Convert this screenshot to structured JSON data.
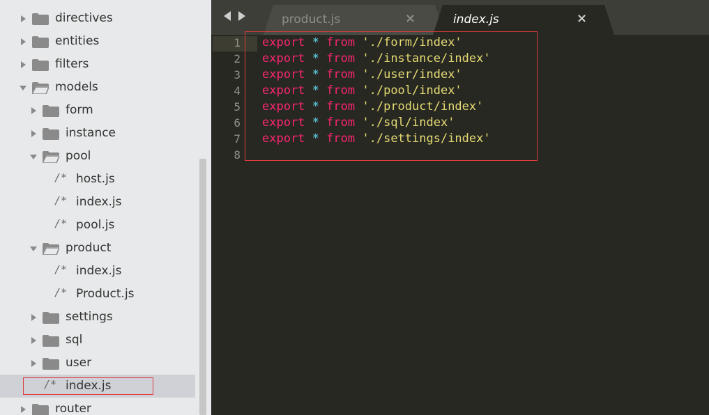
{
  "sidebar": {
    "items": [
      {
        "label": "directives",
        "kind": "folder",
        "state": "collapsed"
      },
      {
        "label": "entities",
        "kind": "folder",
        "state": "collapsed"
      },
      {
        "label": "filters",
        "kind": "folder",
        "state": "collapsed"
      },
      {
        "label": "models",
        "kind": "folder",
        "state": "expanded"
      },
      {
        "label": "form",
        "kind": "folder",
        "state": "collapsed"
      },
      {
        "label": "instance",
        "kind": "folder",
        "state": "collapsed"
      },
      {
        "label": "pool",
        "kind": "folder",
        "state": "expanded"
      },
      {
        "label": "host.js",
        "kind": "file",
        "icon": "/*"
      },
      {
        "label": "index.js",
        "kind": "file",
        "icon": "/*"
      },
      {
        "label": "pool.js",
        "kind": "file",
        "icon": "/*"
      },
      {
        "label": "product",
        "kind": "folder",
        "state": "expanded"
      },
      {
        "label": "index.js",
        "kind": "file",
        "icon": "/*"
      },
      {
        "label": "Product.js",
        "kind": "file",
        "icon": "/*"
      },
      {
        "label": "settings",
        "kind": "folder",
        "state": "collapsed"
      },
      {
        "label": "sql",
        "kind": "folder",
        "state": "collapsed"
      },
      {
        "label": "user",
        "kind": "folder",
        "state": "collapsed"
      },
      {
        "label": "index.js",
        "kind": "file",
        "icon": "/*",
        "selected": true
      },
      {
        "label": "router",
        "kind": "folder",
        "state": "collapsed"
      }
    ]
  },
  "tabs": [
    {
      "label": "product.js",
      "close": "×",
      "active": false
    },
    {
      "label": "index.js",
      "close": "×",
      "active": true
    }
  ],
  "editor": {
    "line_numbers": [
      "1",
      "2",
      "3",
      "4",
      "5",
      "6",
      "7",
      "8"
    ],
    "lines": [
      {
        "kw": "export",
        "op": "*",
        "from": "from",
        "str": "'./form/index'"
      },
      {
        "kw": "export",
        "op": "*",
        "from": "from",
        "str": "'./instance/index'"
      },
      {
        "kw": "export",
        "op": "*",
        "from": "from",
        "str": "'./user/index'"
      },
      {
        "kw": "export",
        "op": "*",
        "from": "from",
        "str": "'./pool/index'"
      },
      {
        "kw": "export",
        "op": "*",
        "from": "from",
        "str": "'./product/index'"
      },
      {
        "kw": "export",
        "op": "*",
        "from": "from",
        "str": "'./sql/index'"
      },
      {
        "kw": "export",
        "op": "*",
        "from": "from",
        "str": "'./settings/index'"
      }
    ]
  },
  "colors": {
    "keyword": "#f92672",
    "operator": "#66d9ef",
    "string": "#e6db74",
    "highlight_box": "#e0393e",
    "editor_bg": "#272822",
    "sidebar_bg": "#e8e9ea"
  }
}
